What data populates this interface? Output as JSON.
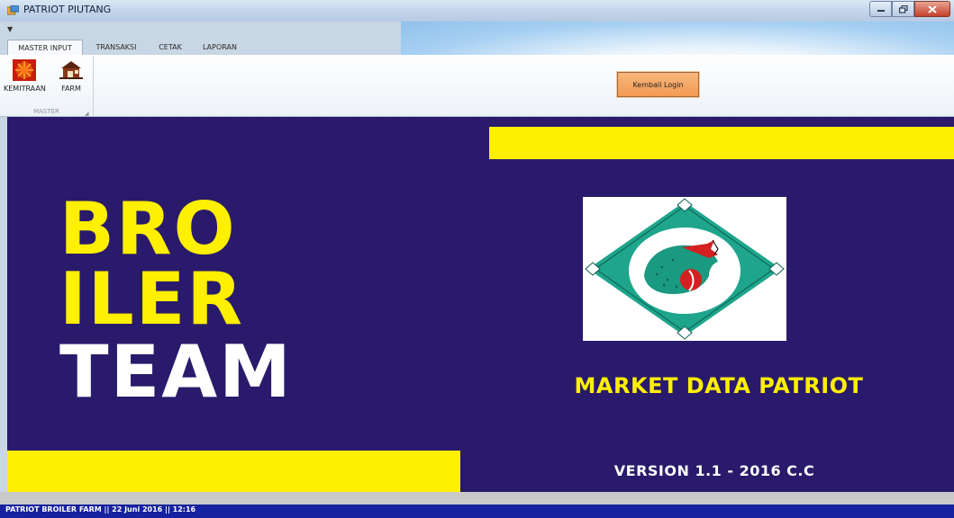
{
  "window": {
    "title": "PATRIOT PIUTANG",
    "icon": "app-icon"
  },
  "ribbon": {
    "tabs": [
      {
        "label": "MASTER INPUT",
        "active": true
      },
      {
        "label": "TRANSAKSI",
        "active": false
      },
      {
        "label": "CETAK",
        "active": false
      },
      {
        "label": "LAPORAN",
        "active": false
      }
    ],
    "group": {
      "label": "MASTER",
      "buttons": [
        {
          "label": "KEMITRAAN",
          "icon": "kemitraan-icon"
        },
        {
          "label": "FARM",
          "icon": "farm-icon"
        }
      ]
    },
    "kembali_label": "Kembali Login"
  },
  "main": {
    "line1": "BRO",
    "line2": "ILER",
    "line3": "TEAM",
    "market": "MARKET DATA PATRIOT",
    "version": "VERSION 1.1 - 2016 C.C",
    "colors": {
      "background": "#2a1a6b",
      "accent": "#ffef00",
      "logo_teal": "#1ea58c",
      "logo_red": "#d42020"
    }
  },
  "status": {
    "text": "PATRIOT BROILER FARM  ||  22 Juni 2016  ||  12:16"
  }
}
